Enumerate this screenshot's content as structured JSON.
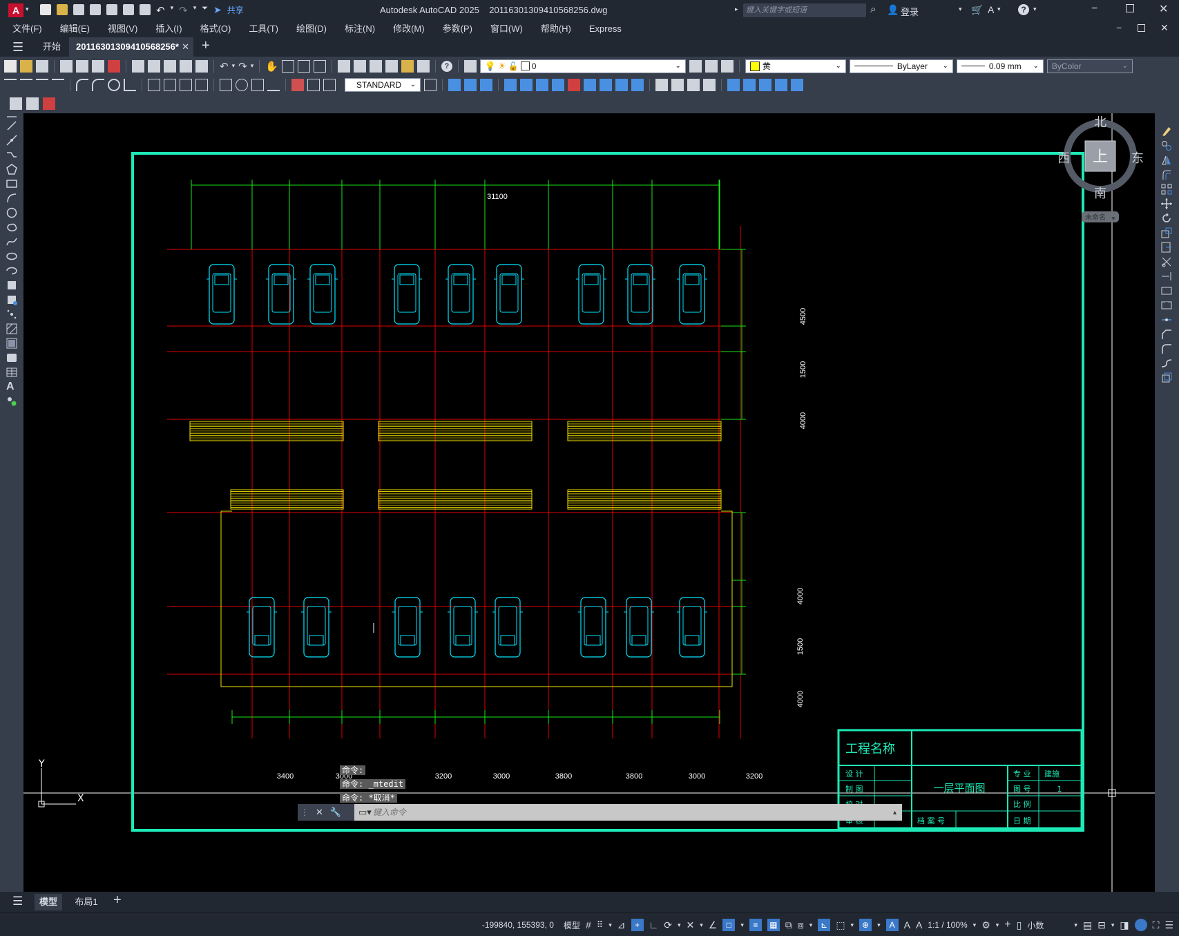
{
  "app": {
    "title": "Autodesk AutoCAD 2025",
    "filename": "20116301309410568256.dwg",
    "search_placeholder": "键入关键字或短语",
    "login": "登录",
    "share": "共享"
  },
  "menu": [
    "文件(F)",
    "编辑(E)",
    "视图(V)",
    "插入(I)",
    "格式(O)",
    "工具(T)",
    "绘图(D)",
    "标注(N)",
    "修改(M)",
    "参数(P)",
    "窗口(W)",
    "帮助(H)",
    "Express"
  ],
  "tabs": {
    "start": "开始",
    "active": "20116301309410568256*"
  },
  "toolbar": {
    "layer": "0",
    "color": "黄",
    "linetype": "ByLayer",
    "lineweight": "0.09 mm",
    "plotstyle": "ByColor",
    "dimstyle": "STANDARD"
  },
  "viewcube": {
    "north": "北",
    "south": "南",
    "east": "东",
    "west": "西",
    "top": "上",
    "wcs": "未命名"
  },
  "drawing": {
    "overall_dim": "31100",
    "right_dims_top": [
      "4500",
      "1500",
      "4000"
    ],
    "right_dims_bottom": [
      "4000",
      "1500",
      "4000"
    ],
    "bottom_dims": [
      "3400",
      "3000",
      "3200",
      "3000",
      "3800",
      "3800",
      "3000",
      "3200"
    ],
    "title_block": {
      "project": "工程名称",
      "design": "设 计",
      "draw": "制 图",
      "check": "校 对",
      "review": "审 核",
      "drawing_name": "一层平面图",
      "archive": "档 案 号",
      "discipline_label": "专 业",
      "discipline": "建施",
      "number_label": "图 号",
      "number": "1",
      "scale_label": "比 例",
      "date_label": "日 期"
    },
    "ucs_x": "X",
    "ucs_y": "Y"
  },
  "command": {
    "history": [
      "命令:",
      "命令: _mtedit",
      "命令: *取消*"
    ],
    "placeholder": "键入命令"
  },
  "layout_tabs": [
    "模型",
    "布局1"
  ],
  "status": {
    "coords": "-199840, 155393, 0",
    "model": "模型",
    "scale": "1:1 / 100%",
    "units": "小数"
  },
  "colors": {
    "canvas": "#000000",
    "frame": "#1de9b6",
    "axis_red": "#e00000",
    "dim_green": "#19e619",
    "car_cyan": "#00e5ff",
    "yellow": "#f0e000"
  }
}
